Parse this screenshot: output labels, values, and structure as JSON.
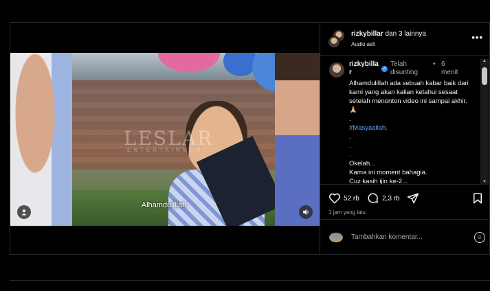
{
  "post": {
    "header": {
      "username": "rizkybillar",
      "others": "dan 3 lainnya",
      "audio": "Audio asli",
      "more_icon": "more-dots-icon"
    },
    "video": {
      "subtitle": "Alhamdulillah,",
      "watermark": "LESLAR",
      "watermark_sub": "ENTERTAINMENT",
      "user_icon": "person-icon",
      "sound_icon": "speaker-icon"
    },
    "caption": {
      "username_line1": "rizkybilla",
      "username_line2": "r",
      "edited": "Telah disunting",
      "separator": "•",
      "time_ago": "6 menit",
      "body_line1": "Alhamdulillah ada sebuah kabar baik dari kami yang akan kalian ketahui sesaat setelah menonton video ini sampai akhir. 🙏🏼",
      "dot": ".",
      "hashtag": "#Masyaallah.",
      "okelah": "Okelah...",
      "karna": "Karna ini moment bahagia.",
      "cut_line": "Cuz kasih ijin ke-2..."
    },
    "actions": {
      "likes": "52 rb",
      "comments": "2,3 rb",
      "posted": "1 jam yang lalu"
    },
    "add_comment": {
      "placeholder": "Tambahkan komentar..."
    }
  }
}
